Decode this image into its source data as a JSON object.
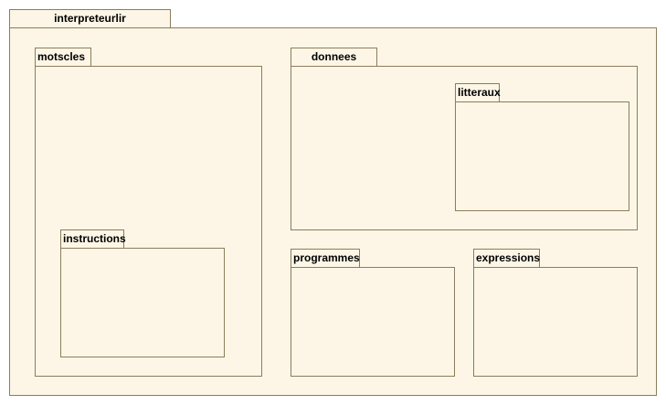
{
  "packages": {
    "root": {
      "label": "interpreteurlir"
    },
    "motscles": {
      "label": "motscles"
    },
    "instructions": {
      "label": "instructions"
    },
    "donnees": {
      "label": "donnees"
    },
    "litteraux": {
      "label": "litteraux"
    },
    "programmes": {
      "label": "programmes"
    },
    "expressions": {
      "label": "expressions"
    }
  },
  "colors": {
    "fill": "#fdf6e6",
    "border": "#8b7d5d",
    "text": "#000000"
  }
}
